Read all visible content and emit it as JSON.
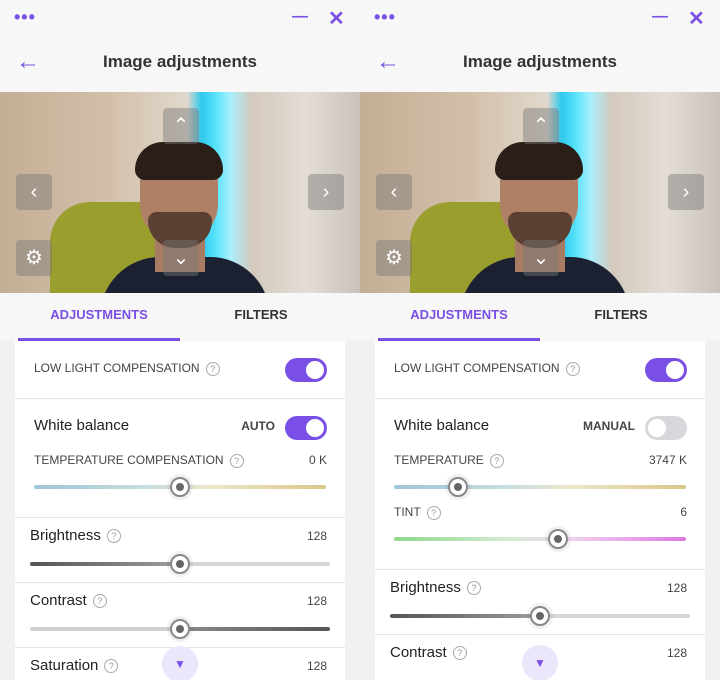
{
  "window": {
    "menu_icon": "more-dots-icon",
    "minimize_icon": "minimize-icon",
    "close_icon": "close-icon"
  },
  "header": {
    "title": "Image adjustments",
    "back_icon": "arrow-left-icon"
  },
  "tabs": [
    "ADJUSTMENTS",
    "FILTERS"
  ],
  "colors": {
    "accent": "#7a4fe6"
  },
  "left": {
    "low_light": {
      "label": "LOW LIGHT COMPENSATION",
      "on": true
    },
    "white_balance": {
      "label": "White balance",
      "mode": "AUTO",
      "on": true
    },
    "temperature_comp": {
      "label": "TEMPERATURE COMPENSATION",
      "value": "0 K",
      "fraction": 0.5
    },
    "brightness": {
      "label": "Brightness",
      "value": "128",
      "fraction": 0.5
    },
    "contrast": {
      "label": "Contrast",
      "value": "128",
      "fraction": 0.5
    },
    "saturation": {
      "label": "Saturation",
      "value": "128"
    }
  },
  "right": {
    "low_light": {
      "label": "LOW LIGHT COMPENSATION",
      "on": true
    },
    "white_balance": {
      "label": "White balance",
      "mode": "MANUAL",
      "on": false
    },
    "temperature": {
      "label": "TEMPERATURE",
      "value": "3747 K",
      "fraction": 0.22
    },
    "tint": {
      "label": "TINT",
      "value": "6",
      "fraction": 0.56
    },
    "brightness": {
      "label": "Brightness",
      "value": "128",
      "fraction": 0.5
    },
    "contrast": {
      "label": "Contrast",
      "value": "128"
    }
  }
}
